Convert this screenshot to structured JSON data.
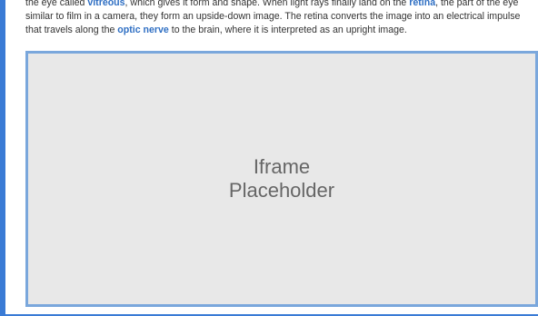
{
  "article": {
    "seg1": "the eye called ",
    "term_vitreous": "vitreous",
    "seg2": ", which gives it form and shape. When light rays finally land on the ",
    "term_retina": "retina",
    "seg3": ", the part of the eye similar to film in a camera, they form an upside-down image. The retina converts the image into an electrical impulse that travels along the ",
    "term_optic_nerve": "optic nerve",
    "seg4": " to the brain, where it is interpreted as an upright image."
  },
  "iframe": {
    "line1": "Iframe",
    "line2": "Placeholder"
  },
  "colors": {
    "accent": "#3a7bd5",
    "term_link": "#2f6fc3",
    "placeholder_bg": "#e8e8e8",
    "placeholder_border": "#7aa7dc"
  }
}
